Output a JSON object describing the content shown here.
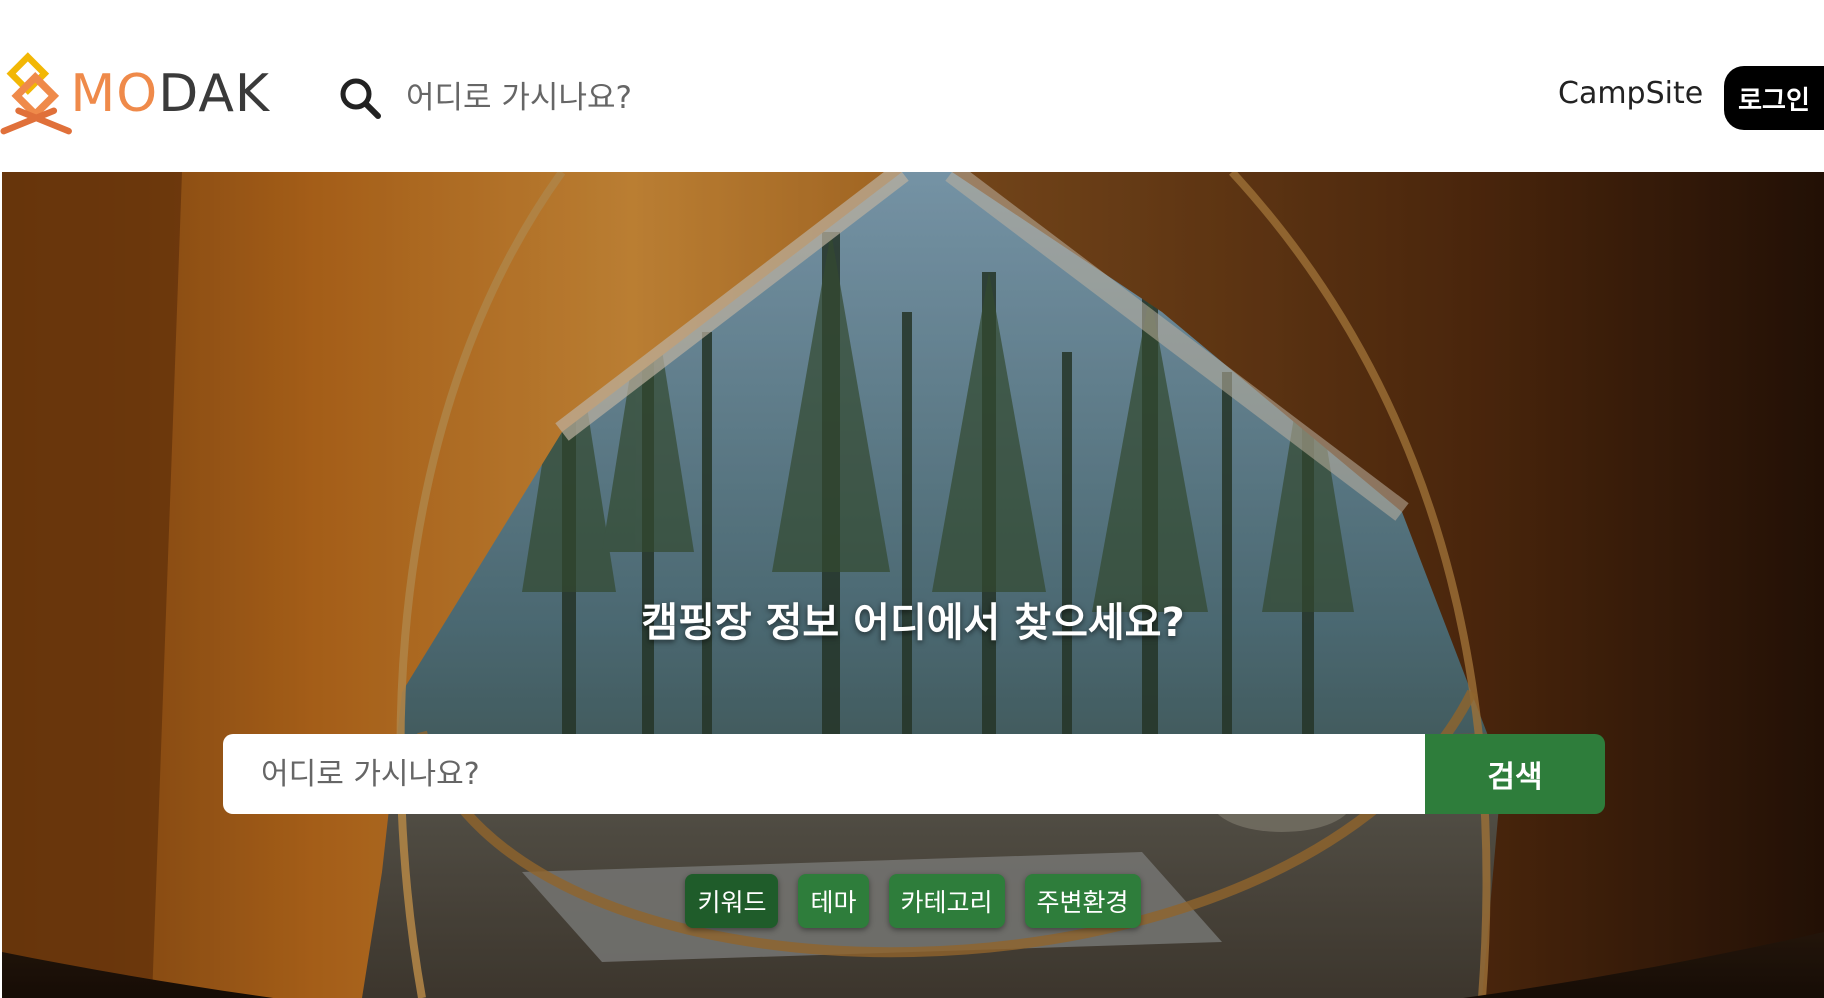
{
  "header": {
    "logo": {
      "text_mo": "MO",
      "text_dak": "DAK"
    },
    "search": {
      "placeholder": "어디로 가시나요?",
      "icon": "search-icon"
    },
    "nav": {
      "campsite_label": "CampSite",
      "login_label": "로그인"
    }
  },
  "hero": {
    "title": "캠핑장 정보 어디에서 찾으세요?",
    "search": {
      "placeholder": "어디로 가시나요?",
      "button_label": "검색"
    },
    "chips": [
      {
        "label": "키워드",
        "selected": true
      },
      {
        "label": "테마",
        "selected": false
      },
      {
        "label": "카테고리",
        "selected": false
      },
      {
        "label": "주변환경",
        "selected": false
      }
    ]
  },
  "colors": {
    "accent_green": "#2e7d3b",
    "accent_green_dark": "#1f5c2a",
    "logo_orange": "#ef8a4a",
    "logo_yellow": "#f2b705"
  }
}
